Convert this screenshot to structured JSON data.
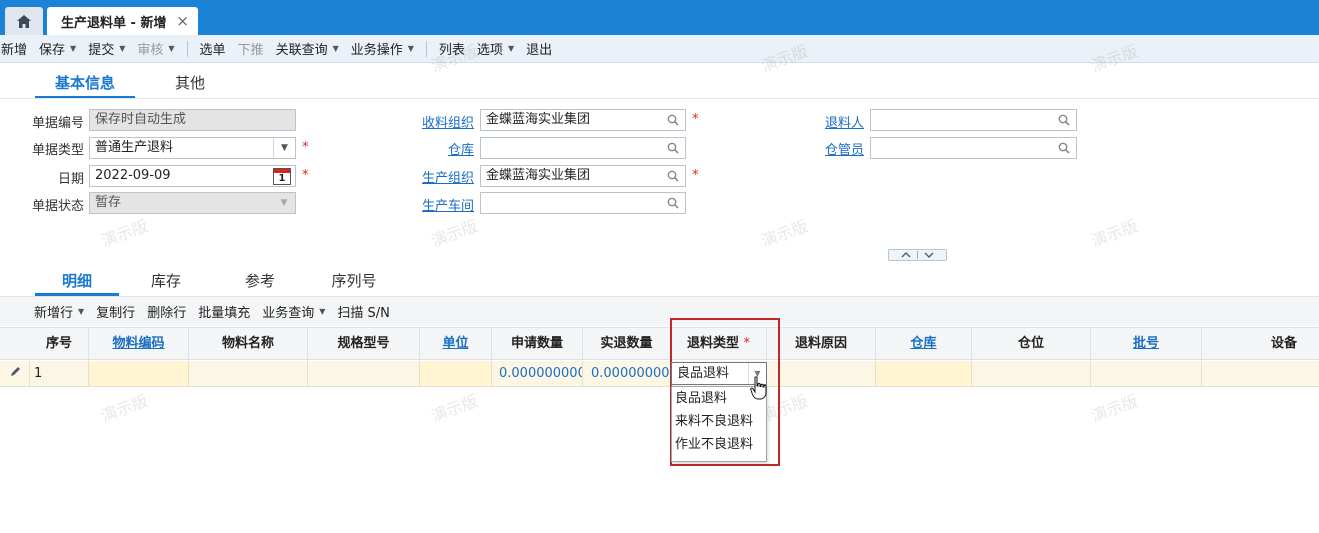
{
  "tabs_bar": {
    "doc_tab_title": "生产退料单 - 新增",
    "close_glyph": "×"
  },
  "toolbar": [
    {
      "label": "新增",
      "caret": false,
      "disabled": false
    },
    {
      "label": "保存",
      "caret": true,
      "disabled": false
    },
    {
      "label": "提交",
      "caret": true,
      "disabled": false
    },
    {
      "label": "审核",
      "caret": true,
      "disabled": true
    },
    {
      "label": "选单",
      "caret": false,
      "disabled": false
    },
    {
      "label": "下推",
      "caret": false,
      "disabled": true
    },
    {
      "label": "关联查询",
      "caret": true,
      "disabled": false
    },
    {
      "label": "业务操作",
      "caret": true,
      "disabled": false
    },
    {
      "label": "列表",
      "caret": false,
      "disabled": false
    },
    {
      "label": "选项",
      "caret": true,
      "disabled": false
    },
    {
      "label": "退出",
      "caret": false,
      "disabled": false
    }
  ],
  "header_tabs": [
    "基本信息",
    "其他"
  ],
  "form": {
    "bill_no": {
      "label": "单据编号",
      "value": "保存时自动生成"
    },
    "bill_type": {
      "label": "单据类型",
      "value": "普通生产退料"
    },
    "date": {
      "label": "日期",
      "value": "2022-09-09",
      "calendar_day": "1"
    },
    "status": {
      "label": "单据状态",
      "value": "暂存"
    },
    "recv_org": {
      "label": "收料组织",
      "value": "金蝶蓝海实业集团"
    },
    "warehouse": {
      "label": "仓库",
      "value": ""
    },
    "prod_org": {
      "label": "生产组织",
      "value": "金蝶蓝海实业集团"
    },
    "workshop": {
      "label": "生产车间",
      "value": ""
    },
    "returner": {
      "label": "退料人",
      "value": ""
    },
    "keeper": {
      "label": "仓管员",
      "value": ""
    },
    "required_mark": "*"
  },
  "watermark": "演示版",
  "detail_tabs": [
    "明细",
    "库存",
    "参考",
    "序列号"
  ],
  "grid_toolbar": [
    {
      "label": "新增行",
      "caret": true
    },
    {
      "label": "复制行",
      "caret": false
    },
    {
      "label": "删除行",
      "caret": false
    },
    {
      "label": "批量填充",
      "caret": false
    },
    {
      "label": "业务查询",
      "caret": true
    },
    {
      "label": "扫描 S/N",
      "caret": false
    }
  ],
  "grid": {
    "columns": [
      "序号",
      "物料编码",
      "物料名称",
      "规格型号",
      "单位",
      "申请数量",
      "实退数量",
      "退料类型",
      "退料原因",
      "仓库",
      "仓位",
      "批号",
      "设备"
    ],
    "rows": [
      {
        "seq": "1",
        "apply_qty": "0.0000000000",
        "actual_qty": "0.0000000000",
        "return_type": "良品退料"
      }
    ]
  },
  "dropdown_options": [
    "良品退料",
    "来料不良退料",
    "作业不良退料"
  ]
}
